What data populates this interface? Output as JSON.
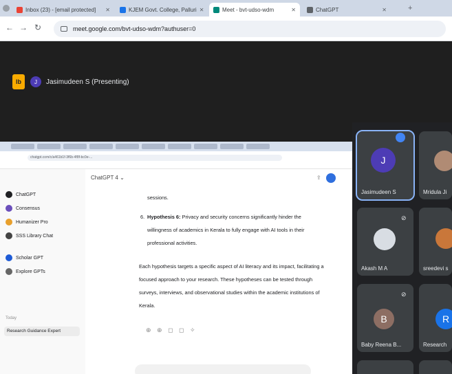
{
  "browser": {
    "tabs": [
      {
        "label": "Inbox (23) - [email protected]",
        "favicon_color": "#ea4335"
      },
      {
        "label": "KJEM Govt. College, Palluri",
        "favicon_color": "#1a73e8"
      },
      {
        "label": "Meet - bvt-udso-wdm",
        "favicon_color": "#00897b"
      },
      {
        "label": "ChatGPT",
        "favicon_color": "#5f6368"
      }
    ],
    "new_tab": "+",
    "url": "meet.google.com/bvt-udso-wdm?authuser=0"
  },
  "meet": {
    "presenter_initial": "J",
    "presenter_label": "Jasimudeen S (Presenting)",
    "logo_text": "lb"
  },
  "shared_screen": {
    "address": "chatgpt.com/c/a461b1f-3f6b-4f8f-bc0e-...",
    "chat_header": "ChatGPT 4 ⌄",
    "sidebar_items": [
      {
        "label": "ChatGPT",
        "color": "#202124"
      },
      {
        "label": "Consensus",
        "color": "#6b4fbb"
      },
      {
        "label": "Humanizer Pro",
        "color": "#e8a02d"
      },
      {
        "label": "SSS Library Chat",
        "color": "#444"
      },
      {
        "label": "Scholar GPT",
        "color": "#1e5bd6"
      },
      {
        "label": "Explore GPTs",
        "color": "#666"
      }
    ],
    "sidebar_heading": "Today",
    "sidebar_history": "Research Guidance Expert",
    "body": {
      "fragment": "sessions.",
      "hypothesis_label": "Hypothesis 6:",
      "hypothesis_text": "Privacy and security concerns significantly hinder the willingness of academics in Kerala to fully engage with AI tools in their professional activities.",
      "summary": "Each hypothesis targets a specific aspect of AI literacy and its impact, facilitating a focused approach to your research. These hypotheses can be tested through surveys, interviews, and observational studies within the academic institutions of Kerala."
    },
    "actions": "⊕ ⊕ ◻ ◻ ✧"
  },
  "participants": [
    {
      "name": "Jasimudeen S",
      "initial": "J",
      "avatar_color": "#4d3cb5"
    },
    {
      "name": "Mridula Ji",
      "initial": "",
      "avatar_color": "#b08b74"
    },
    {
      "name": "Akash M A",
      "initial": "",
      "avatar_color": "#d8dde3"
    },
    {
      "name": "sreedevi s",
      "initial": "",
      "avatar_color": "#c9773a"
    },
    {
      "name": "Baby Reena B...",
      "initial": "B",
      "avatar_color": "#8d6e63"
    },
    {
      "name": "Research",
      "initial": "R",
      "avatar_color": "#1a73e8"
    }
  ]
}
